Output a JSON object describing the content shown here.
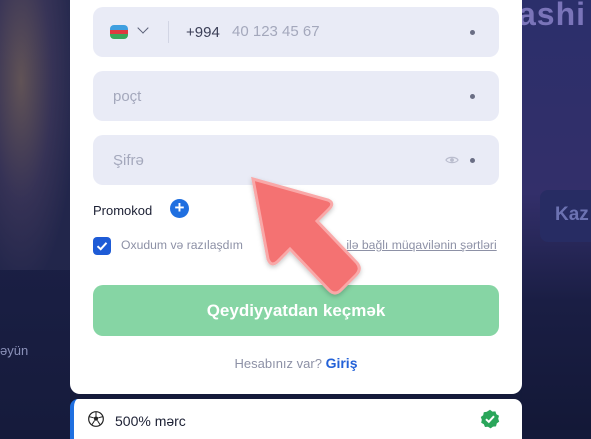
{
  "background": {
    "left_text": "əyün",
    "right_word": "ashi",
    "right_button": "Kaz"
  },
  "form": {
    "phone": {
      "country_flag": "azerbaijan-flag-icon",
      "dial_code": "+994",
      "placeholder": "40 123 45 67",
      "value": ""
    },
    "email": {
      "placeholder": "poçt",
      "value": ""
    },
    "password": {
      "placeholder": "Şifrə",
      "value": ""
    },
    "promocode_label": "Promokod",
    "promocode_add_icon": "plus-icon",
    "terms": {
      "checked": true,
      "text_before": "Oxudum və razılaşdım ",
      "link_part1": "",
      "text_middle": "",
      "link_text": "ilə bağlı müqavilənin şərtləri"
    },
    "submit_label": "Qeydiyyatdan keçmək",
    "have_account_text": "Hesabınız var?",
    "login_link": "Giriş"
  },
  "bonus": {
    "icon": "soccer-ball-icon",
    "label": "500% mərc",
    "status_icon": "verified-check-icon"
  },
  "colors": {
    "accent": "#1f6fe0",
    "submit_bg": "#86d5a4",
    "field_bg": "#e9ebf6",
    "arrow": "#f26a6a"
  }
}
